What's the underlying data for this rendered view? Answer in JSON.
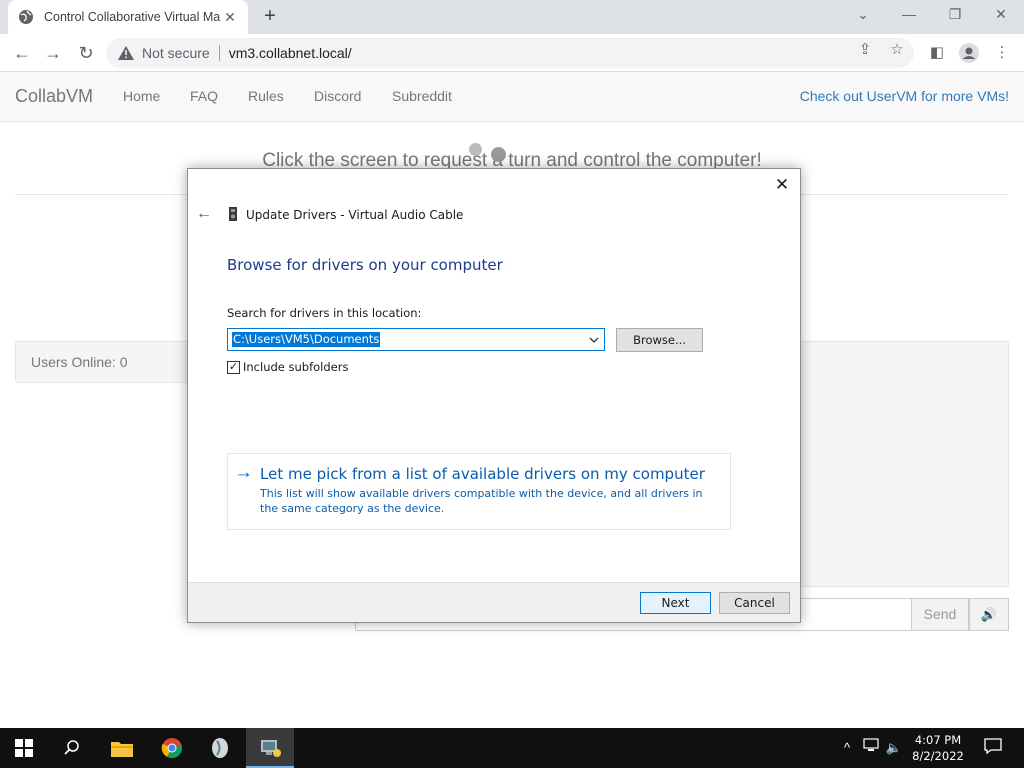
{
  "browser": {
    "tab_title": "Control Collaborative Virtual Ma",
    "tab_close": "✕",
    "new_tab": "+",
    "window_controls": {
      "minimize": "—",
      "restore": "❐",
      "close": "✕",
      "dropdown": "⌄"
    },
    "security_label": "Not secure",
    "url": "vm3.collabnet.local/"
  },
  "site": {
    "brand": "CollabVM",
    "nav": [
      "Home",
      "FAQ",
      "Rules",
      "Discord",
      "Subreddit"
    ],
    "nav_right": "Check out UserVM for more VMs!",
    "click_prompt": "Click the screen to request a turn and control the computer!",
    "users_online": "Users Online: 0",
    "send_label": "Send",
    "link_color": "#337ab7"
  },
  "dialog": {
    "title": "Update Drivers - Virtual Audio Cable",
    "heading": "Browse for drivers on your computer",
    "search_label": "Search for drivers in this location:",
    "path_value": "C:\\Users\\VM5\\Documents",
    "browse_label": "Browse...",
    "include_subfolders_label": "Include subfolders",
    "include_subfolders_checked": true,
    "pick_title": "Let me pick from a list of available drivers on my computer",
    "pick_description": "This list will show available drivers compatible with the device, and all drivers in the same category as the device.",
    "next_label": "Next",
    "cancel_label": "Cancel",
    "close_glyph": "✕",
    "back_glyph": "←",
    "heading_color": "#1e3b8c",
    "link_color": "#0b5cad"
  },
  "taskbar": {
    "time": "4:07 PM",
    "date": "8/2/2022",
    "apps": [
      "start-icon",
      "search-icon",
      "file-explorer-icon",
      "chrome-icon",
      "app-icon",
      "device-manager-icon"
    ]
  }
}
